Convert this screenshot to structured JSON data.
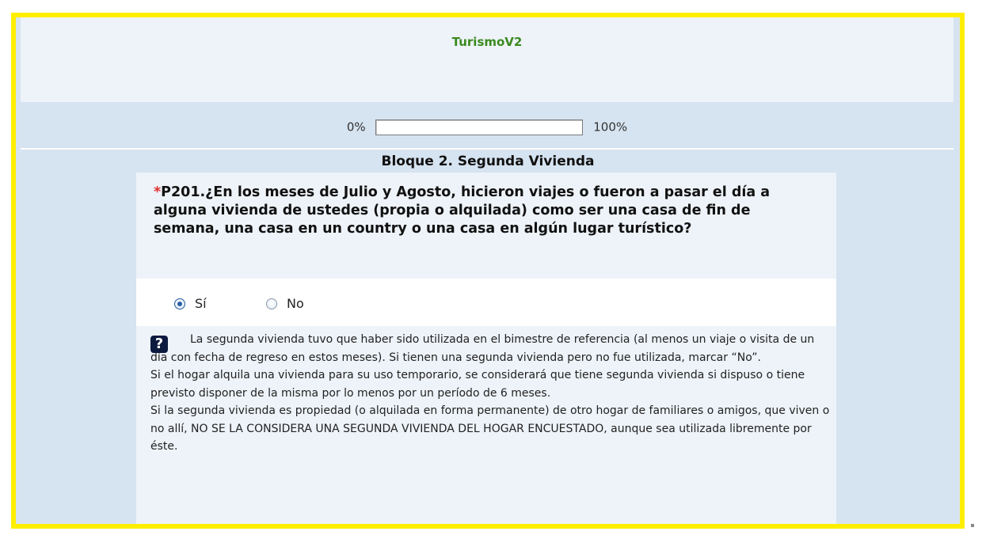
{
  "app": {
    "title": "TurismoV2"
  },
  "progress": {
    "start_label": "0%",
    "end_label": "100%",
    "value_percent": 0
  },
  "block": {
    "title": "Bloque 2. Segunda Vivienda"
  },
  "question": {
    "required_marker": "*",
    "text": "P201.¿En los meses de Julio y Agosto, hicieron viajes o fueron a pasar el día a alguna vivienda de ustedes (propia o alquilada) como ser una casa de fin de semana, una casa en un country o una casa en algún lugar turístico?",
    "options": [
      {
        "label": "Sí",
        "selected": true
      },
      {
        "label": "No",
        "selected": false
      }
    ]
  },
  "help": {
    "icon_label": "?",
    "icon": "question-icon",
    "paragraph1": "La segunda vivienda tuvo que haber sido utilizada en el bimestre de referencia (al menos un viaje o visita de un día con fecha de regreso en estos meses). Si tienen una segunda vivienda pero no fue utilizada, marcar “No”.",
    "paragraph2": "Si el hogar alquila una vivienda para su uso temporario, se considerará que tiene segunda vivienda si dispuso o tiene previsto disponer de la misma por lo menos por un período de 6 meses.",
    "paragraph3": "Si la segunda vivienda es propiedad (o alquilada en forma permanente) de otro hogar de familiares o amigos, que viven o no allí, NO SE LA CONSIDERA UNA SEGUNDA VIVIENDA DEL HOGAR ENCUESTADO, aunque sea utilizada libremente por éste."
  },
  "colors": {
    "frame": "#ffee00",
    "title_green": "#3a8a1f",
    "panel_bg": "#d6e3f0",
    "light_bg": "#eef3f9"
  }
}
